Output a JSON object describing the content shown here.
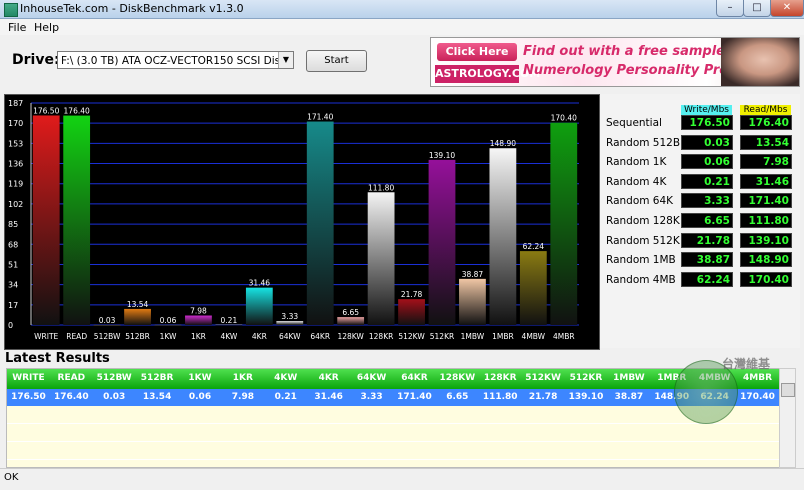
{
  "window": {
    "title": "InhouseTek.com - DiskBenchmark v1.3.0"
  },
  "window_buttons": {
    "minimize": "–",
    "maximize": "□",
    "close": "✕"
  },
  "menu": [
    "File",
    "Help"
  ],
  "toolbar": {
    "drive_label": "Drive:",
    "drive_value": "F:\\ (3.0 TB) ATA OCZ-VECTOR150 SCSI Disk Dev",
    "start_label": "Start"
  },
  "ad": {
    "click_label": "Click Here",
    "brand": "ASTROLOGY.COM",
    "line1": "Find out with a free sample",
    "line2": "Numerology Personality Profile!"
  },
  "chart_data": {
    "type": "bar",
    "title": "",
    "categories": [
      "WRITE",
      "READ",
      "512BW",
      "512BR",
      "1KW",
      "1KR",
      "4KW",
      "4KR",
      "64KW",
      "64KR",
      "128KW",
      "128KR",
      "512KW",
      "512KR",
      "1MBW",
      "1MBR",
      "4MBW",
      "4MBR"
    ],
    "values": [
      176.5,
      176.4,
      0.03,
      13.54,
      0.06,
      7.98,
      0.21,
      31.46,
      3.33,
      171.4,
      6.65,
      111.8,
      21.78,
      139.1,
      38.87,
      148.9,
      62.24,
      170.4
    ],
    "value_labels": [
      "176.50",
      "176.40",
      "0.03",
      "13.54",
      "0.06",
      "7.98",
      "0.21",
      "31.46",
      "3.33",
      "171.40",
      "6.65",
      "111.80",
      "21.78",
      "139.10",
      "38.87",
      "148.90",
      "62.24",
      "170.40"
    ],
    "colors": [
      "#e01b1b",
      "#12d312",
      "#e9d1a4",
      "#e07a12",
      "#d6d6d6",
      "#cc2bcc",
      "#f0f0f0",
      "#16e3e3",
      "#e8e8e8",
      "#168a8a",
      "#e8a0a0",
      "#f4f4f4",
      "#a4101a",
      "#95109a",
      "#f1c7a5",
      "#f6f6f6",
      "#8a7b12",
      "#0fa00f"
    ],
    "yticks": [
      0,
      17,
      34,
      51,
      68,
      85,
      102,
      119,
      136,
      153,
      170,
      187
    ],
    "ylim": [
      0,
      187
    ],
    "grid": true
  },
  "results": {
    "write_header": "Write/Mbs",
    "read_header": "Read/Mbs",
    "rows": [
      {
        "label": "Sequential",
        "write": "176.50",
        "read": "176.40"
      },
      {
        "label": "Random 512B",
        "write": "0.03",
        "read": "13.54"
      },
      {
        "label": "Random 1K",
        "write": "0.06",
        "read": "7.98"
      },
      {
        "label": "Random 4K",
        "write": "0.21",
        "read": "31.46"
      },
      {
        "label": "Random 64K",
        "write": "3.33",
        "read": "171.40"
      },
      {
        "label": "Random 128K",
        "write": "6.65",
        "read": "111.80"
      },
      {
        "label": "Random 512K",
        "write": "21.78",
        "read": "139.10"
      },
      {
        "label": "Random 1MB",
        "write": "38.87",
        "read": "148.90"
      },
      {
        "label": "Random 4MB",
        "write": "62.24",
        "read": "170.40"
      }
    ]
  },
  "latest": {
    "title": "Latest Results",
    "columns": [
      "WRITE",
      "READ",
      "512BW",
      "512BR",
      "1KW",
      "1KR",
      "4KW",
      "4KR",
      "64KW",
      "64KR",
      "128KW",
      "128KR",
      "512KW",
      "512KR",
      "1MBW",
      "1MBR",
      "4MBW",
      "4MBR"
    ],
    "row": [
      "176.50",
      "176.40",
      "0.03",
      "13.54",
      "0.06",
      "7.98",
      "0.21",
      "31.46",
      "3.33",
      "171.40",
      "6.65",
      "111.80",
      "21.78",
      "139.10",
      "38.87",
      "148.90",
      "62.24",
      "170.40"
    ]
  },
  "watermark": "台灣維基",
  "status": "OK"
}
